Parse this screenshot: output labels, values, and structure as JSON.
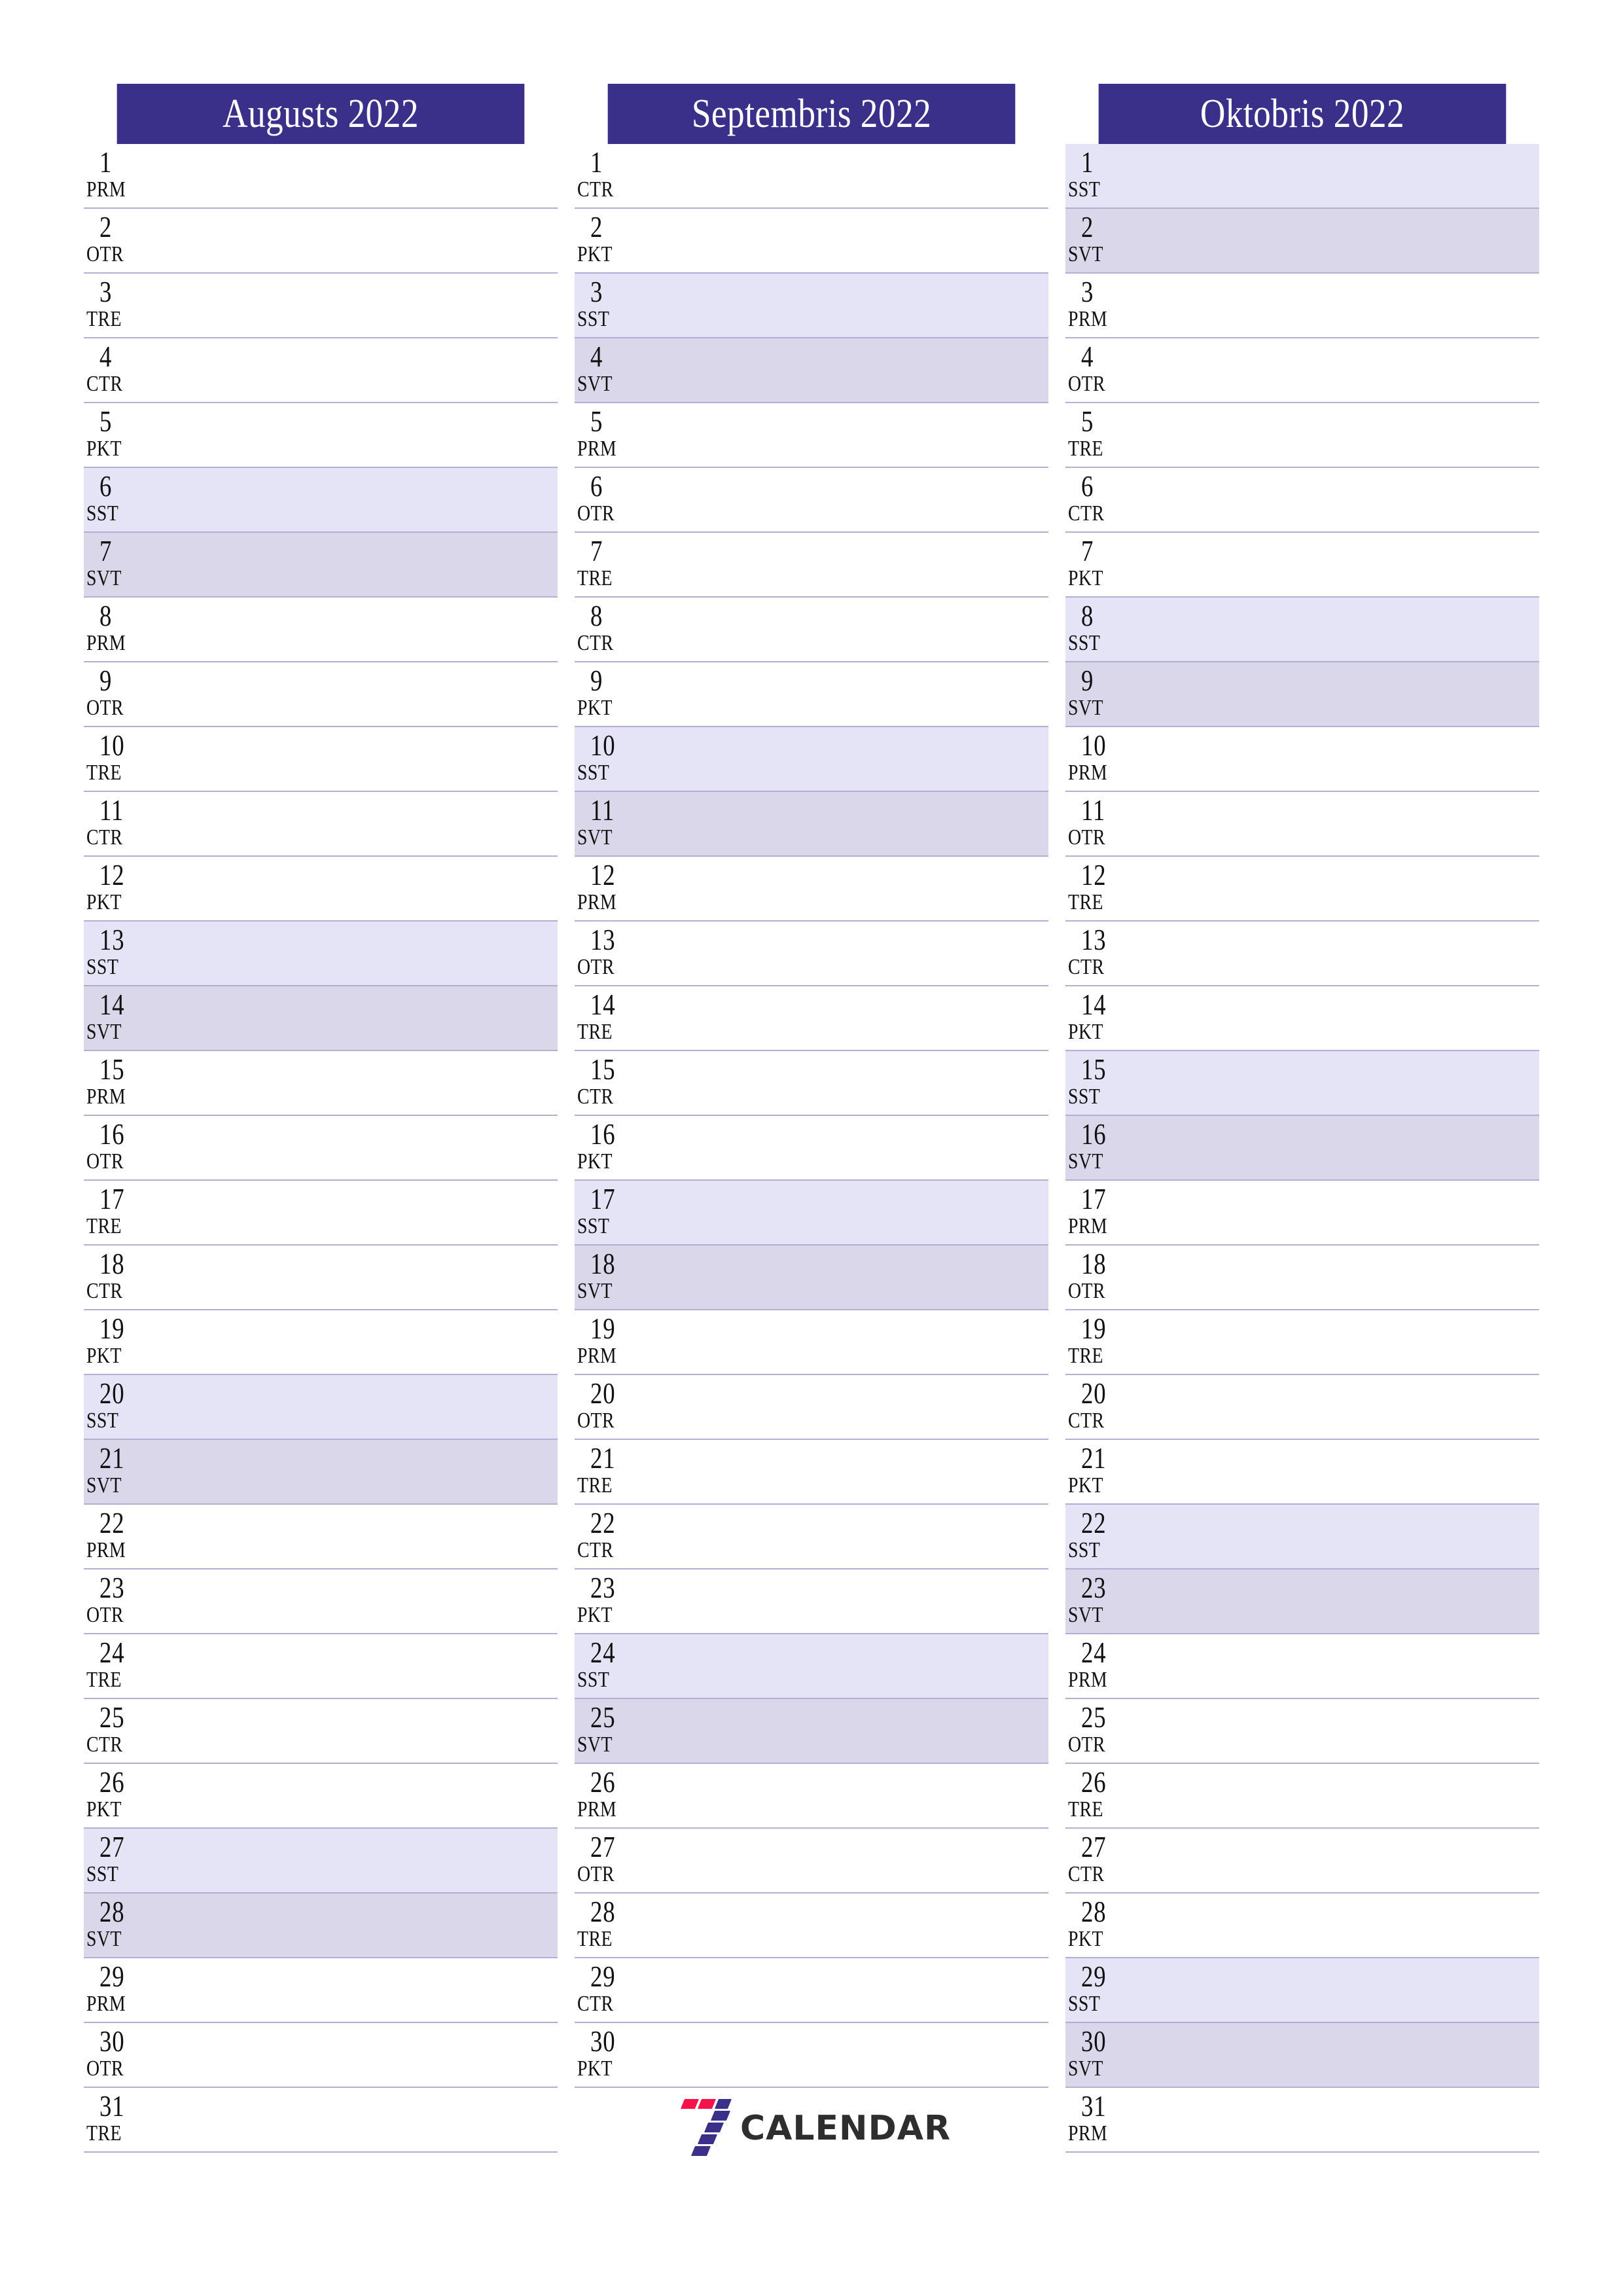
{
  "document": {
    "type": "printable-calendar-planner",
    "year": "2022",
    "locale_weekday_labels": [
      "PRM",
      "OTR",
      "TRE",
      "CTR",
      "PKT",
      "SST",
      "SVT"
    ]
  },
  "colors": {
    "header_bg": "#3a3089",
    "header_text": "#ffffff",
    "row_divider": "#b3aed4",
    "saturday_bg": "#e5e4f6",
    "sunday_bg": "#dbd7ea",
    "day_text": "#111111",
    "logo_red": "#f5124a",
    "logo_blue": "#3a3089",
    "logo_word": "#2e2e2e"
  },
  "footer": {
    "logo": {
      "mark_name": "seven-logo-mark",
      "wordmark": "CALENDAR",
      "digit": "7"
    }
  },
  "months": [
    {
      "id": "august",
      "title": "Augusts 2022",
      "days": [
        {
          "n": "1",
          "dow": "PRM",
          "type": "weekday"
        },
        {
          "n": "2",
          "dow": "OTR",
          "type": "weekday"
        },
        {
          "n": "3",
          "dow": "TRE",
          "type": "weekday"
        },
        {
          "n": "4",
          "dow": "CTR",
          "type": "weekday"
        },
        {
          "n": "5",
          "dow": "PKT",
          "type": "weekday"
        },
        {
          "n": "6",
          "dow": "SST",
          "type": "saturday"
        },
        {
          "n": "7",
          "dow": "SVT",
          "type": "sunday"
        },
        {
          "n": "8",
          "dow": "PRM",
          "type": "weekday"
        },
        {
          "n": "9",
          "dow": "OTR",
          "type": "weekday"
        },
        {
          "n": "10",
          "dow": "TRE",
          "type": "weekday"
        },
        {
          "n": "11",
          "dow": "CTR",
          "type": "weekday"
        },
        {
          "n": "12",
          "dow": "PKT",
          "type": "weekday"
        },
        {
          "n": "13",
          "dow": "SST",
          "type": "saturday"
        },
        {
          "n": "14",
          "dow": "SVT",
          "type": "sunday"
        },
        {
          "n": "15",
          "dow": "PRM",
          "type": "weekday"
        },
        {
          "n": "16",
          "dow": "OTR",
          "type": "weekday"
        },
        {
          "n": "17",
          "dow": "TRE",
          "type": "weekday"
        },
        {
          "n": "18",
          "dow": "CTR",
          "type": "weekday"
        },
        {
          "n": "19",
          "dow": "PKT",
          "type": "weekday"
        },
        {
          "n": "20",
          "dow": "SST",
          "type": "saturday"
        },
        {
          "n": "21",
          "dow": "SVT",
          "type": "sunday"
        },
        {
          "n": "22",
          "dow": "PRM",
          "type": "weekday"
        },
        {
          "n": "23",
          "dow": "OTR",
          "type": "weekday"
        },
        {
          "n": "24",
          "dow": "TRE",
          "type": "weekday"
        },
        {
          "n": "25",
          "dow": "CTR",
          "type": "weekday"
        },
        {
          "n": "26",
          "dow": "PKT",
          "type": "weekday"
        },
        {
          "n": "27",
          "dow": "SST",
          "type": "saturday"
        },
        {
          "n": "28",
          "dow": "SVT",
          "type": "sunday"
        },
        {
          "n": "29",
          "dow": "PRM",
          "type": "weekday"
        },
        {
          "n": "30",
          "dow": "OTR",
          "type": "weekday"
        },
        {
          "n": "31",
          "dow": "TRE",
          "type": "weekday"
        }
      ]
    },
    {
      "id": "september",
      "title": "Septembris 2022",
      "days": [
        {
          "n": "1",
          "dow": "CTR",
          "type": "weekday"
        },
        {
          "n": "2",
          "dow": "PKT",
          "type": "weekday"
        },
        {
          "n": "3",
          "dow": "SST",
          "type": "saturday"
        },
        {
          "n": "4",
          "dow": "SVT",
          "type": "sunday"
        },
        {
          "n": "5",
          "dow": "PRM",
          "type": "weekday"
        },
        {
          "n": "6",
          "dow": "OTR",
          "type": "weekday"
        },
        {
          "n": "7",
          "dow": "TRE",
          "type": "weekday"
        },
        {
          "n": "8",
          "dow": "CTR",
          "type": "weekday"
        },
        {
          "n": "9",
          "dow": "PKT",
          "type": "weekday"
        },
        {
          "n": "10",
          "dow": "SST",
          "type": "saturday"
        },
        {
          "n": "11",
          "dow": "SVT",
          "type": "sunday"
        },
        {
          "n": "12",
          "dow": "PRM",
          "type": "weekday"
        },
        {
          "n": "13",
          "dow": "OTR",
          "type": "weekday"
        },
        {
          "n": "14",
          "dow": "TRE",
          "type": "weekday"
        },
        {
          "n": "15",
          "dow": "CTR",
          "type": "weekday"
        },
        {
          "n": "16",
          "dow": "PKT",
          "type": "weekday"
        },
        {
          "n": "17",
          "dow": "SST",
          "type": "saturday"
        },
        {
          "n": "18",
          "dow": "SVT",
          "type": "sunday"
        },
        {
          "n": "19",
          "dow": "PRM",
          "type": "weekday"
        },
        {
          "n": "20",
          "dow": "OTR",
          "type": "weekday"
        },
        {
          "n": "21",
          "dow": "TRE",
          "type": "weekday"
        },
        {
          "n": "22",
          "dow": "CTR",
          "type": "weekday"
        },
        {
          "n": "23",
          "dow": "PKT",
          "type": "weekday"
        },
        {
          "n": "24",
          "dow": "SST",
          "type": "saturday"
        },
        {
          "n": "25",
          "dow": "SVT",
          "type": "sunday"
        },
        {
          "n": "26",
          "dow": "PRM",
          "type": "weekday"
        },
        {
          "n": "27",
          "dow": "OTR",
          "type": "weekday"
        },
        {
          "n": "28",
          "dow": "TRE",
          "type": "weekday"
        },
        {
          "n": "29",
          "dow": "CTR",
          "type": "weekday"
        },
        {
          "n": "30",
          "dow": "PKT",
          "type": "weekday"
        }
      ]
    },
    {
      "id": "october",
      "title": "Oktobris 2022",
      "days": [
        {
          "n": "1",
          "dow": "SST",
          "type": "saturday"
        },
        {
          "n": "2",
          "dow": "SVT",
          "type": "sunday"
        },
        {
          "n": "3",
          "dow": "PRM",
          "type": "weekday"
        },
        {
          "n": "4",
          "dow": "OTR",
          "type": "weekday"
        },
        {
          "n": "5",
          "dow": "TRE",
          "type": "weekday"
        },
        {
          "n": "6",
          "dow": "CTR",
          "type": "weekday"
        },
        {
          "n": "7",
          "dow": "PKT",
          "type": "weekday"
        },
        {
          "n": "8",
          "dow": "SST",
          "type": "saturday"
        },
        {
          "n": "9",
          "dow": "SVT",
          "type": "sunday"
        },
        {
          "n": "10",
          "dow": "PRM",
          "type": "weekday"
        },
        {
          "n": "11",
          "dow": "OTR",
          "type": "weekday"
        },
        {
          "n": "12",
          "dow": "TRE",
          "type": "weekday"
        },
        {
          "n": "13",
          "dow": "CTR",
          "type": "weekday"
        },
        {
          "n": "14",
          "dow": "PKT",
          "type": "weekday"
        },
        {
          "n": "15",
          "dow": "SST",
          "type": "saturday"
        },
        {
          "n": "16",
          "dow": "SVT",
          "type": "sunday"
        },
        {
          "n": "17",
          "dow": "PRM",
          "type": "weekday"
        },
        {
          "n": "18",
          "dow": "OTR",
          "type": "weekday"
        },
        {
          "n": "19",
          "dow": "TRE",
          "type": "weekday"
        },
        {
          "n": "20",
          "dow": "CTR",
          "type": "weekday"
        },
        {
          "n": "21",
          "dow": "PKT",
          "type": "weekday"
        },
        {
          "n": "22",
          "dow": "SST",
          "type": "saturday"
        },
        {
          "n": "23",
          "dow": "SVT",
          "type": "sunday"
        },
        {
          "n": "24",
          "dow": "PRM",
          "type": "weekday"
        },
        {
          "n": "25",
          "dow": "OTR",
          "type": "weekday"
        },
        {
          "n": "26",
          "dow": "TRE",
          "type": "weekday"
        },
        {
          "n": "27",
          "dow": "CTR",
          "type": "weekday"
        },
        {
          "n": "28",
          "dow": "PKT",
          "type": "weekday"
        },
        {
          "n": "29",
          "dow": "SST",
          "type": "saturday"
        },
        {
          "n": "30",
          "dow": "SVT",
          "type": "sunday"
        },
        {
          "n": "31",
          "dow": "PRM",
          "type": "weekday"
        }
      ]
    }
  ]
}
